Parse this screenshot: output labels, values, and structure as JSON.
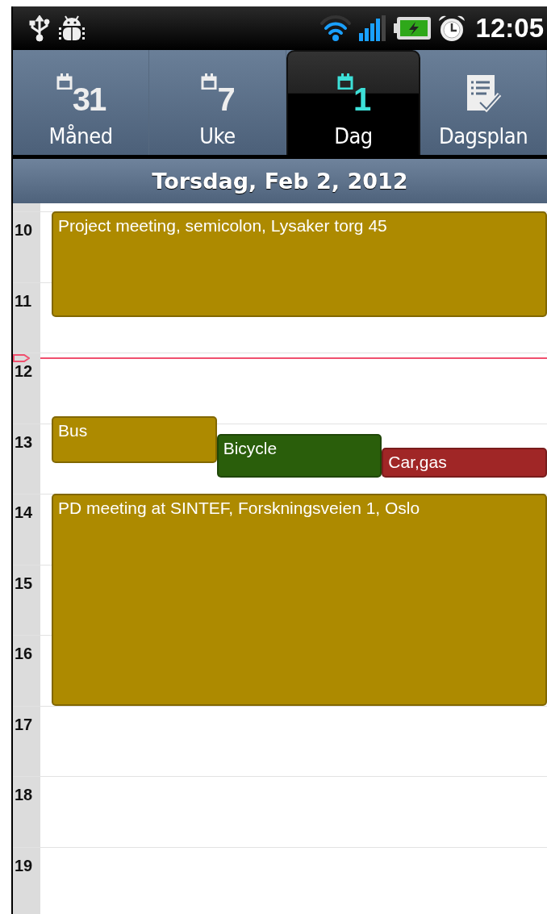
{
  "status_bar": {
    "left_icons": [
      {
        "kind": "usb"
      },
      {
        "kind": "bug"
      }
    ],
    "right_icons": [
      {
        "kind": "wifi"
      },
      {
        "kind": "signal"
      },
      {
        "kind": "battery"
      },
      {
        "kind": "alarm"
      }
    ],
    "time": "12:05"
  },
  "tabs": [
    {
      "label": "Måned",
      "kind": "calendar",
      "icon_text": "31",
      "selected": false
    },
    {
      "label": "Uke",
      "kind": "calendar",
      "icon_text": "7",
      "selected": false
    },
    {
      "label": "Dag",
      "kind": "calendar",
      "icon_text": "1",
      "selected": true
    },
    {
      "label": "Dagsplan",
      "kind": "agenda",
      "selected": false
    }
  ],
  "date_header": "Torsdag, Feb 2, 2012",
  "day_view": {
    "hours": [
      "10",
      "11",
      "12",
      "13",
      "14",
      "15",
      "16",
      "17",
      "18",
      "19"
    ],
    "events": [
      {
        "title": "Project meeting, semicolon, Lysaker torg 45",
        "color": "#ad8a00"
      },
      {
        "title": "Bus",
        "color": "#ad8a00"
      },
      {
        "title": "Bicycle",
        "color": "#2a5e0b"
      },
      {
        "title": "Car,gas",
        "color": "#a02626"
      },
      {
        "title": "PD meeting at SINTEF, Forskningsveien 1, Oslo",
        "color": "#ad8a00"
      }
    ]
  }
}
